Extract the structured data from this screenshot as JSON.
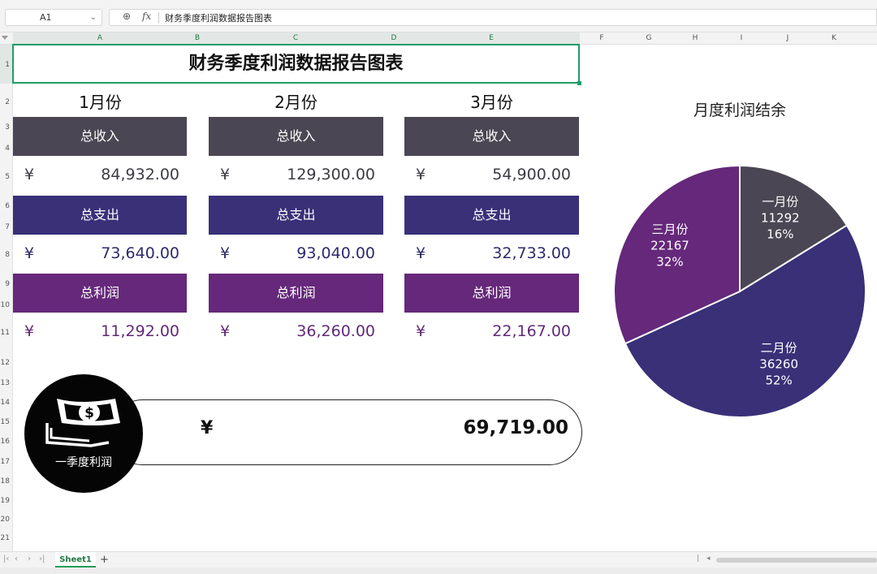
{
  "formula_bar": {
    "cell_ref": "A1",
    "formula": "财务季度利润数据报告图表"
  },
  "columns": [
    "A",
    "B",
    "C",
    "D",
    "E",
    "F",
    "G",
    "H",
    "I",
    "J",
    "K"
  ],
  "rows": [
    "1",
    "2",
    "3",
    "4",
    "5",
    "6",
    "7",
    "8",
    "9",
    "10",
    "11",
    "12",
    "13",
    "14",
    "15",
    "16",
    "17",
    "18",
    "19",
    "20",
    "21"
  ],
  "sheet": {
    "title": "财务季度利润数据报告图表",
    "months": [
      {
        "name": "1月份",
        "income_label": "总收入",
        "income": "84,932.00",
        "expense_label": "总支出",
        "expense": "73,640.00",
        "profit_label": "总利润",
        "profit": "11,292.00"
      },
      {
        "name": "2月份",
        "income_label": "总收入",
        "income": "129,300.00",
        "expense_label": "总支出",
        "expense": "93,040.00",
        "profit_label": "总利润",
        "profit": "36,260.00"
      },
      {
        "name": "3月份",
        "income_label": "总收入",
        "income": "54,900.00",
        "expense_label": "总支出",
        "expense": "32,733.00",
        "profit_label": "总利润",
        "profit": "22,167.00"
      }
    ],
    "currency": "¥",
    "total": {
      "label": "一季度利润",
      "currency": "¥",
      "value": "69,719.00"
    }
  },
  "colors": {
    "header_dark": "#4a4653",
    "header_navy": "#393078",
    "header_purple": "#65287a",
    "selection_green": "#1f9d6a"
  },
  "icons": {
    "money": "money-stack-icon",
    "zoom": "zoom-icon",
    "fx": "fx-icon"
  },
  "chart_data": {
    "type": "pie",
    "title": "月度利润结余",
    "series": [
      {
        "name": "一月份",
        "value": 11292,
        "percent": "16%",
        "color": "#4a4653"
      },
      {
        "name": "二月份",
        "value": 36260,
        "percent": "52%",
        "color": "#393078"
      },
      {
        "name": "三月份",
        "value": 22167,
        "percent": "32%",
        "color": "#65287a"
      }
    ]
  },
  "bottom": {
    "sheet_tab": "Sheet1",
    "add_tab": "+"
  }
}
